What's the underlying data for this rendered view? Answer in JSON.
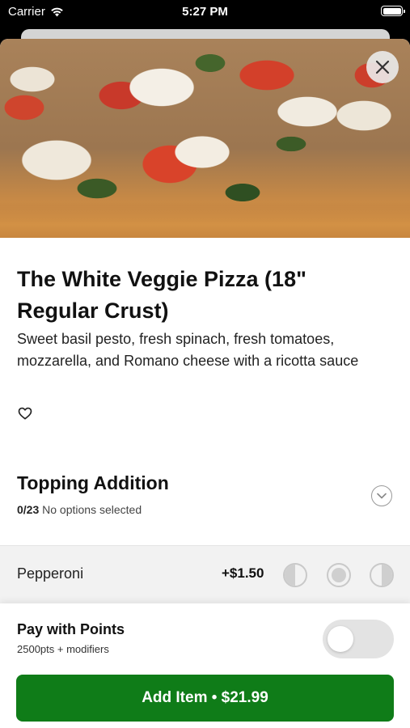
{
  "status_bar": {
    "carrier": "Carrier",
    "time": "5:27 PM",
    "wifi_icon": "wifi-icon",
    "battery_icon": "battery-icon"
  },
  "item": {
    "title": "The White Veggie Pizza (18\" Regular Crust)",
    "description": "Sweet basil pesto, fresh spinach, fresh tomatoes, mozzarella, and Romano cheese with a ricotta sauce",
    "favorite_icon": "heart-outline-icon",
    "close_icon": "close-icon"
  },
  "topping_section": {
    "title": "Topping Addition",
    "count": "0/23",
    "status": "No options selected",
    "expand_icon": "chevron-down-icon"
  },
  "options": [
    {
      "name": "Pepperoni",
      "price": "+$1.50",
      "placements": [
        "left-half-icon",
        "whole-icon",
        "right-half-icon"
      ]
    }
  ],
  "points": {
    "title": "Pay with Points",
    "subtitle": "2500pts + modifiers",
    "enabled": false
  },
  "cta": {
    "label": "Add Item • $21.99"
  },
  "colors": {
    "accent": "#0f7c18",
    "toggle_off": "#e3e3e3"
  }
}
